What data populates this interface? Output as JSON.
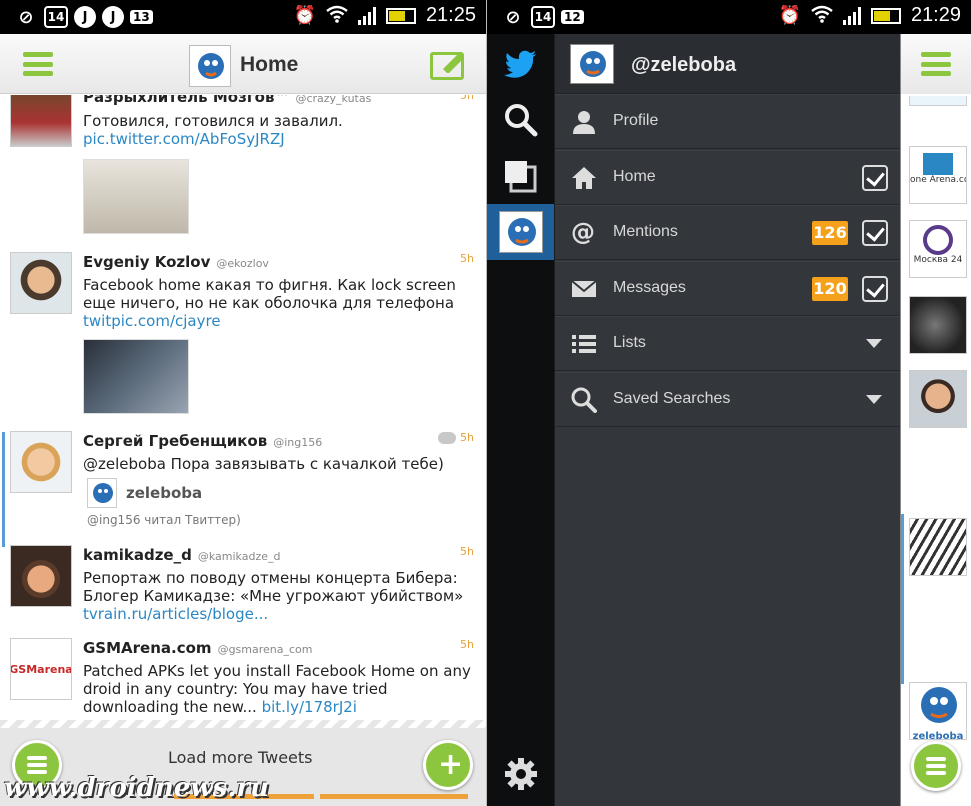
{
  "left_phone": {
    "status": {
      "notif_14": "14",
      "notif_j1": "J",
      "notif_j2": "J",
      "notif_count": "13",
      "time": "21:25"
    },
    "header": {
      "title": "Home"
    },
    "tweets": [
      {
        "name": "Разрыхлитель Мозгов™",
        "handle": "@crazy_kutas",
        "time": "5h",
        "text": "Готовился, готовился и завалил. ",
        "link": "pic.twitter.com/AbFoSyJRZJ"
      },
      {
        "name": "Evgeniy Kozlov",
        "handle": "@ekozlov",
        "time": "5h",
        "text": "Facebook home какая то фигня. Как lock screen еще ничего, но не как оболочка для телефона ",
        "link": "twitpic.com/cjayre"
      },
      {
        "name": "Сергей Гребенщиков",
        "handle": "@ing156",
        "time": "5h",
        "text": "@zeleboba Пора завязывать с качалкой тебе)",
        "link": "",
        "quote_name": "zeleboba",
        "reply_note": "@ing156 читал Твиттер)"
      },
      {
        "name": "kamikadze_d",
        "handle": "@kamikadze_d",
        "time": "5h",
        "text": "Репортаж по поводу отмены концерта Бибера: Блогер Камикадзе: «Мне угрожают убийством» ",
        "link": "tvrain.ru/articles/bloge..."
      },
      {
        "name": "GSMArena.com",
        "handle": "@gsmarena_com",
        "time": "5h",
        "text": "Patched APKs let you install Facebook Home on any droid in any country: You may have tried downloading the new... ",
        "link": "bit.ly/178rJ2i",
        "avatar_text": "GSMarena"
      }
    ],
    "footer": {
      "load_more": "Load more Tweets"
    },
    "watermark": "www.droidnews.ru"
  },
  "right_phone": {
    "status": {
      "notif_14": "14",
      "notif_count": "12",
      "time": "21:29"
    },
    "menu": {
      "handle": "@zeleboba",
      "items": [
        {
          "label": "Profile",
          "icon": "person-icon"
        },
        {
          "label": "Home",
          "icon": "home-icon",
          "checked": true
        },
        {
          "label": "Mentions",
          "icon": "at-icon",
          "count": "126",
          "checked": true
        },
        {
          "label": "Messages",
          "icon": "envelope-icon",
          "count": "120",
          "checked": true
        },
        {
          "label": "Lists",
          "icon": "list-icon",
          "expandable": true
        },
        {
          "label": "Saved Searches",
          "icon": "search-icon",
          "expandable": true
        }
      ]
    },
    "peek_avatar_text": [
      "one Arena.co",
      "Москва 24",
      "zeleboba"
    ]
  },
  "colors": {
    "accent_green": "#8cc63f",
    "link_blue": "#2b87c4",
    "badge_orange": "#f5a11c",
    "time_orange": "#e3a23a",
    "twitter_blue": "#1da1f2"
  }
}
